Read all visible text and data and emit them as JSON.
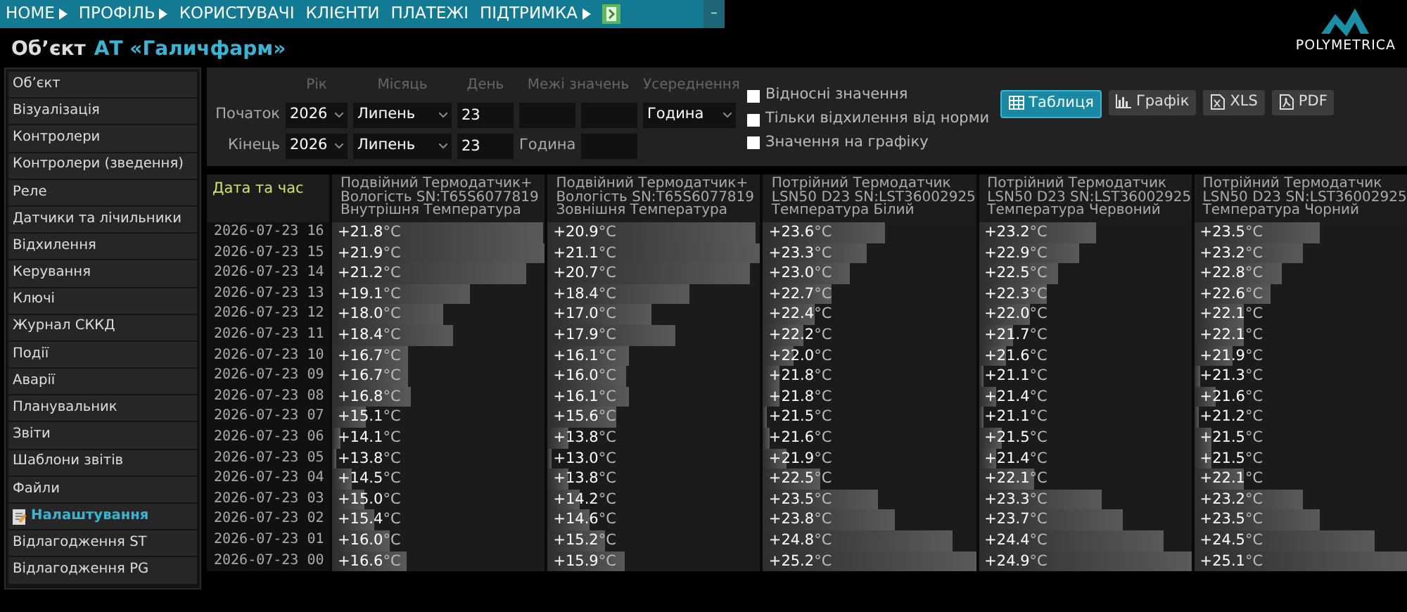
{
  "top_menu": [
    {
      "label": "HOME",
      "has_submenu": true
    },
    {
      "label": "ПРОФІЛЬ",
      "has_submenu": true
    },
    {
      "label": "КОРИСТУВАЧІ",
      "has_submenu": false
    },
    {
      "label": "КЛІЄНТИ",
      "has_submenu": false
    },
    {
      "label": "ПЛАТЕЖІ",
      "has_submenu": false
    },
    {
      "label": "ПІДТРИМКА",
      "has_submenu": true
    }
  ],
  "collapse_button": "–",
  "logo": {
    "text": "POLYMETRICA"
  },
  "object": {
    "label": "Об’єкт",
    "name": "АТ «Галичфарм»"
  },
  "sidebar": {
    "items": [
      {
        "label": "Об’єкт",
        "selected": false
      },
      {
        "label": "Візуалізація",
        "selected": false
      },
      {
        "label": "Контролери",
        "selected": false
      },
      {
        "label": "Контролери (зведення)",
        "selected": false
      },
      {
        "label": "Реле",
        "selected": false
      },
      {
        "label": "Датчики та лічильники",
        "selected": false
      },
      {
        "label": "Відхилення",
        "selected": false
      },
      {
        "label": "Керування",
        "selected": false
      },
      {
        "label": "Ключі",
        "selected": false
      },
      {
        "label": "Журнал СККД",
        "selected": false
      },
      {
        "label": "Події",
        "selected": false
      },
      {
        "label": "Аварії",
        "selected": false
      },
      {
        "label": "Планувальник",
        "selected": false
      },
      {
        "label": "Звіти",
        "selected": false
      },
      {
        "label": "Шаблони звітів",
        "selected": false
      },
      {
        "label": "Файли",
        "selected": false
      },
      {
        "label": "Налаштування",
        "selected": true
      },
      {
        "label": "Відлагодження ST",
        "selected": false
      },
      {
        "label": "Відлагодження PG",
        "selected": false
      }
    ]
  },
  "filter": {
    "headers": [
      "Рік",
      "Місяць",
      "День",
      "Межі значень",
      "Усереднення"
    ],
    "start": {
      "label": "Початок",
      "year": "2026",
      "month": "Липень",
      "day": "23",
      "averaging": "Година"
    },
    "end": {
      "label": "Кінець",
      "year": "2026",
      "month": "Липень",
      "day": "23",
      "hour_label": "Година"
    },
    "checkboxes": [
      {
        "label": "Відносні значення",
        "checked": false
      },
      {
        "label": "Тільки відхилення від норми",
        "checked": false
      },
      {
        "label": "Значення на графіку",
        "checked": false
      }
    ],
    "views": [
      {
        "label": "Таблиця",
        "kind": "table",
        "selected": true
      },
      {
        "label": "Графік",
        "kind": "chart",
        "selected": false
      },
      {
        "label": "XLS",
        "kind": "xls",
        "selected": false
      },
      {
        "label": "PDF",
        "kind": "pdf",
        "selected": false
      }
    ]
  },
  "table": {
    "date_header": "Дата та час",
    "columns": [
      {
        "lines": [
          "Подвійний Термодатчик+",
          "Вологість SN:T65S6077819",
          "Внутрішня Температура"
        ]
      },
      {
        "lines": [
          "Подвійний Термодатчик+",
          "Вологість SN:T65S6077819",
          "Зовнішня Температура"
        ]
      },
      {
        "lines": [
          "Потрійний Термодатчик",
          "LSN50 D23 SN:LST36002925",
          "Температура Білий"
        ]
      },
      {
        "lines": [
          "Потрійний Термодатчик",
          "LSN50 D23 SN:LST36002925",
          "Температура Червоний"
        ]
      },
      {
        "lines": [
          "Потрійний Термодатчик",
          "LSN50 D23 SN:LST36002925",
          "Температура Чорний"
        ]
      }
    ],
    "rows": [
      {
        "time": "2026-07-23 16",
        "cells": [
          {
            "value": "+21.8",
            "unit": "°C",
            "level": 0.99
          },
          {
            "value": "+20.9",
            "unit": "°C",
            "level": 0.98
          },
          {
            "value": "+23.6",
            "unit": "°C",
            "level": 0.57
          },
          {
            "value": "+23.2",
            "unit": "°C",
            "level": 0.55
          },
          {
            "value": "+23.5",
            "unit": "°C",
            "level": 0.59
          }
        ]
      },
      {
        "time": "2026-07-23 15",
        "cells": [
          {
            "value": "+21.9",
            "unit": "°C",
            "level": 1
          },
          {
            "value": "+21.1",
            "unit": "°C",
            "level": 1
          },
          {
            "value": "+23.3",
            "unit": "°C",
            "level": 0.49
          },
          {
            "value": "+22.9",
            "unit": "°C",
            "level": 0.47
          },
          {
            "value": "+23.2",
            "unit": "°C",
            "level": 0.51
          }
        ]
      },
      {
        "time": "2026-07-23 14",
        "cells": [
          {
            "value": "+21.2",
            "unit": "°C",
            "level": 0.91
          },
          {
            "value": "+20.7",
            "unit": "°C",
            "level": 0.95
          },
          {
            "value": "+23.0",
            "unit": "°C",
            "level": 0.41
          },
          {
            "value": "+22.5",
            "unit": "°C",
            "level": 0.37
          },
          {
            "value": "+22.8",
            "unit": "°C",
            "level": 0.41
          }
        ]
      },
      {
        "time": "2026-07-23 13",
        "cells": [
          {
            "value": "+19.1",
            "unit": "°C",
            "level": 0.65
          },
          {
            "value": "+18.4",
            "unit": "°C",
            "level": 0.67
          },
          {
            "value": "+22.7",
            "unit": "°C",
            "level": 0.32
          },
          {
            "value": "+22.3",
            "unit": "°C",
            "level": 0.32
          },
          {
            "value": "+22.6",
            "unit": "°C",
            "level": 0.36
          }
        ]
      },
      {
        "time": "2026-07-23 12",
        "cells": [
          {
            "value": "+18.0",
            "unit": "°C",
            "level": 0.52
          },
          {
            "value": "+17.0",
            "unit": "°C",
            "level": 0.49
          },
          {
            "value": "+22.4",
            "unit": "°C",
            "level": 0.24
          },
          {
            "value": "+22.0",
            "unit": "°C",
            "level": 0.24
          },
          {
            "value": "+22.1",
            "unit": "°C",
            "level": 0.23
          }
        ]
      },
      {
        "time": "2026-07-23 11",
        "cells": [
          {
            "value": "+18.4",
            "unit": "°C",
            "level": 0.57
          },
          {
            "value": "+17.9",
            "unit": "°C",
            "level": 0.6
          },
          {
            "value": "+22.2",
            "unit": "°C",
            "level": 0.19
          },
          {
            "value": "+21.7",
            "unit": "°C",
            "level": 0.16
          },
          {
            "value": "+22.1",
            "unit": "°C",
            "level": 0.23
          }
        ]
      },
      {
        "time": "2026-07-23 10",
        "cells": [
          {
            "value": "+16.7",
            "unit": "°C",
            "level": 0.36
          },
          {
            "value": "+16.1",
            "unit": "°C",
            "level": 0.38
          },
          {
            "value": "+22.0",
            "unit": "°C",
            "level": 0.14
          },
          {
            "value": "+21.6",
            "unit": "°C",
            "level": 0.13
          },
          {
            "value": "+21.9",
            "unit": "°C",
            "level": 0.18
          }
        ]
      },
      {
        "time": "2026-07-23 09",
        "cells": [
          {
            "value": "+16.7",
            "unit": "°C",
            "level": 0.36
          },
          {
            "value": "+16.0",
            "unit": "°C",
            "level": 0.37
          },
          {
            "value": "+21.8",
            "unit": "°C",
            "level": 0.08
          },
          {
            "value": "+21.1",
            "unit": "°C",
            "level": 0.02
          },
          {
            "value": "+21.3",
            "unit": "°C",
            "level": 0.03
          }
        ]
      },
      {
        "time": "2026-07-23 08",
        "cells": [
          {
            "value": "+16.8",
            "unit": "°C",
            "level": 0.37
          },
          {
            "value": "+16.1",
            "unit": "°C",
            "level": 0.38
          },
          {
            "value": "+21.8",
            "unit": "°C",
            "level": 0.08
          },
          {
            "value": "+21.4",
            "unit": "°C",
            "level": 0.08
          },
          {
            "value": "+21.6",
            "unit": "°C",
            "level": 0.1
          }
        ]
      },
      {
        "time": "2026-07-23 07",
        "cells": [
          {
            "value": "+15.1",
            "unit": "°C",
            "level": 0.16
          },
          {
            "value": "+15.6",
            "unit": "°C",
            "level": 0.32
          },
          {
            "value": "+21.5",
            "unit": "°C",
            "level": 0.02
          },
          {
            "value": "+21.1",
            "unit": "°C",
            "level": 0.02
          },
          {
            "value": "+21.2",
            "unit": "°C",
            "level": 0.02
          }
        ]
      },
      {
        "time": "2026-07-23 06",
        "cells": [
          {
            "value": "+14.1",
            "unit": "°C",
            "level": 0.04
          },
          {
            "value": "+13.8",
            "unit": "°C",
            "level": 0.1
          },
          {
            "value": "+21.6",
            "unit": "°C",
            "level": 0.03
          },
          {
            "value": "+21.5",
            "unit": "°C",
            "level": 0.11
          },
          {
            "value": "+21.5",
            "unit": "°C",
            "level": 0.08
          }
        ]
      },
      {
        "time": "2026-07-23 05",
        "cells": [
          {
            "value": "+13.8",
            "unit": "°C",
            "level": 0.02
          },
          {
            "value": "+13.0",
            "unit": "°C",
            "level": 0.02
          },
          {
            "value": "+21.9",
            "unit": "°C",
            "level": 0.11
          },
          {
            "value": "+21.4",
            "unit": "°C",
            "level": 0.08
          },
          {
            "value": "+21.5",
            "unit": "°C",
            "level": 0.08
          }
        ]
      },
      {
        "time": "2026-07-23 04",
        "cells": [
          {
            "value": "+14.5",
            "unit": "°C",
            "level": 0.09
          },
          {
            "value": "+13.8",
            "unit": "°C",
            "level": 0.1
          },
          {
            "value": "+22.5",
            "unit": "°C",
            "level": 0.27
          },
          {
            "value": "+22.1",
            "unit": "°C",
            "level": 0.26
          },
          {
            "value": "+22.1",
            "unit": "°C",
            "level": 0.23
          }
        ]
      },
      {
        "time": "2026-07-23 03",
        "cells": [
          {
            "value": "+15.0",
            "unit": "°C",
            "level": 0.15
          },
          {
            "value": "+14.2",
            "unit": "°C",
            "level": 0.15
          },
          {
            "value": "+23.5",
            "unit": "°C",
            "level": 0.54
          },
          {
            "value": "+23.3",
            "unit": "°C",
            "level": 0.58
          },
          {
            "value": "+23.2",
            "unit": "°C",
            "level": 0.51
          }
        ]
      },
      {
        "time": "2026-07-23 02",
        "cells": [
          {
            "value": "+15.4",
            "unit": "°C",
            "level": 0.2
          },
          {
            "value": "+14.6",
            "unit": "°C",
            "level": 0.2
          },
          {
            "value": "+23.8",
            "unit": "°C",
            "level": 0.62
          },
          {
            "value": "+23.7",
            "unit": "°C",
            "level": 0.68
          },
          {
            "value": "+23.5",
            "unit": "°C",
            "level": 0.59
          }
        ]
      },
      {
        "time": "2026-07-23 01",
        "cells": [
          {
            "value": "+16.0",
            "unit": "°C",
            "level": 0.27
          },
          {
            "value": "+15.2",
            "unit": "°C",
            "level": 0.27
          },
          {
            "value": "+24.8",
            "unit": "°C",
            "level": 0.89
          },
          {
            "value": "+24.4",
            "unit": "°C",
            "level": 0.87
          },
          {
            "value": "+24.5",
            "unit": "°C",
            "level": 0.85
          }
        ]
      },
      {
        "time": "2026-07-23 00",
        "cells": [
          {
            "value": "+16.6",
            "unit": "°C",
            "level": 0.35
          },
          {
            "value": "+15.9",
            "unit": "°C",
            "level": 0.36
          },
          {
            "value": "+25.2",
            "unit": "°C",
            "level": 1
          },
          {
            "value": "+24.9",
            "unit": "°C",
            "level": 1
          },
          {
            "value": "+25.1",
            "unit": "°C",
            "level": 1
          }
        ]
      }
    ]
  }
}
